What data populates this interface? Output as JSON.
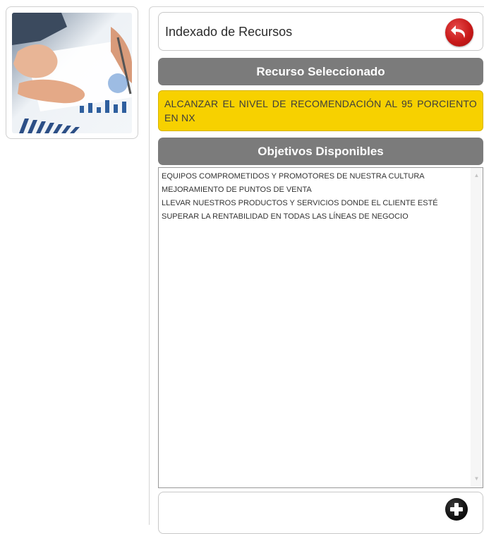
{
  "header": {
    "title": "Indexado de Recursos",
    "back_icon": "undo-arrow-icon",
    "back_color": "#c81a1a"
  },
  "selected_resource": {
    "heading": "Recurso Seleccionado",
    "value": "ALCANZAR EL NIVEL DE RECOMENDACIÓN AL 95 PORCIENTO EN NX",
    "highlight_color": "#f7d100"
  },
  "objectives": {
    "heading": "Objetivos Disponibles",
    "items": [
      "EQUIPOS COMPROMETIDOS Y PROMOTORES DE NUESTRA CULTURA",
      "MEJORAMIENTO DE PUNTOS DE VENTA",
      "LLEVAR NUESTROS PRODUCTOS Y SERVICIOS DONDE EL CLIENTE ESTÉ",
      "SUPERAR LA RENTABILIDAD EN TODAS LAS LÍNEAS DE NEGOCIO"
    ]
  },
  "footer": {
    "add_icon": "plus-circle-icon"
  },
  "colors": {
    "section_bar": "#7b7b7b"
  }
}
